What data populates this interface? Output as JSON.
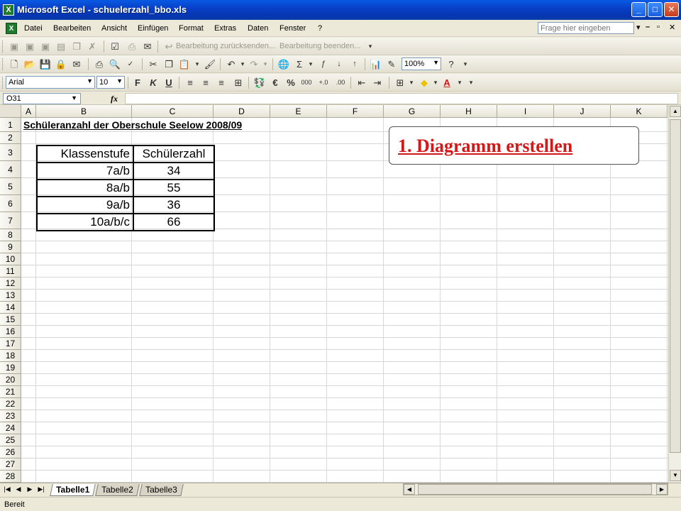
{
  "window": {
    "title": "Microsoft Excel - schuelerzahl_bbo.xls",
    "app_icon": "X",
    "controls": [
      "minimize-icon",
      "maximize-icon",
      "close-icon"
    ]
  },
  "menu": {
    "items": [
      "Datei",
      "Bearbeiten",
      "Ansicht",
      "Einfügen",
      "Format",
      "Extras",
      "Daten",
      "Fenster",
      "?"
    ],
    "help_placeholder": "Frage hier eingeben",
    "mdi_controls": [
      "▾",
      "–",
      "▫",
      "✕"
    ]
  },
  "toolbar_review": {
    "send_back": "Bearbeitung zurücksenden...",
    "end_edit": "Bearbeitung beenden..."
  },
  "toolbar_standard": {
    "zoom": "100%"
  },
  "toolbar_format": {
    "font": "Arial",
    "size": "10",
    "bold": "F",
    "italic": "K",
    "underline": "U"
  },
  "formula_bar": {
    "name_box": "O31",
    "fx": "fx",
    "content": ""
  },
  "grid": {
    "columns": [
      "A",
      "B",
      "C",
      "D",
      "E",
      "F",
      "G",
      "H",
      "I",
      "J",
      "K"
    ],
    "rows": [
      "1",
      "2",
      "3",
      "4",
      "5",
      "6",
      "7",
      "8",
      "9",
      "10",
      "11",
      "12",
      "13",
      "14",
      "15",
      "16",
      "17",
      "18",
      "19",
      "20",
      "21",
      "22",
      "23",
      "24",
      "25",
      "26",
      "27",
      "28"
    ],
    "sheet_title": "Schüleranzahl der Oberschule Seelow 2008/09",
    "table": {
      "headers": [
        "Klassenstufe",
        "Schülerzahl"
      ],
      "rows": [
        [
          "7a/b",
          "34"
        ],
        [
          "8a/b",
          "55"
        ],
        [
          "9a/b",
          "36"
        ],
        [
          "10a/b/c",
          "66"
        ]
      ]
    },
    "callout": "1. Diagramm erstellen"
  },
  "sheets": {
    "tabs": [
      "Tabelle1",
      "Tabelle2",
      "Tabelle3"
    ],
    "active": "Tabelle1"
  },
  "status": {
    "text": "Bereit"
  }
}
